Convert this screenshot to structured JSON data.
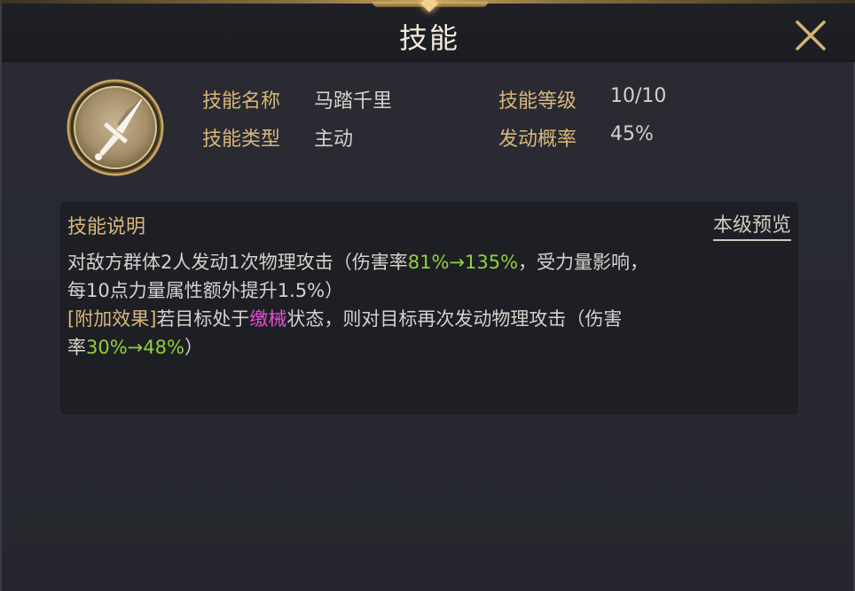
{
  "header": {
    "title": "技能"
  },
  "skill": {
    "name_label": "技能名称",
    "name_value": "马踏千里",
    "level_label": "技能等级",
    "level_value": "10/10",
    "type_label": "技能类型",
    "type_value": "主动",
    "chance_label": "发动概率",
    "chance_value": "45%"
  },
  "description": {
    "title": "技能说明",
    "preview_label": "本级预览",
    "line1_prefix": "对敌方群体2人发动1次物理攻击（伤害率",
    "line1_range": "81%→135%",
    "line1_suffix": "，受力量影响，",
    "line2": "每10点力量属性额外提升1.5%）",
    "line3_tag": "[附加效果]",
    "line3_prefix": "若目标处于",
    "line3_status": "缴械",
    "line3_suffix": "状态，则对目标再次发动物理攻击（伤害",
    "line4_prefix": "率",
    "line4_range": "30%→48%",
    "line4_suffix": "）"
  },
  "colors": {
    "gold_text": "#d9b77a",
    "green_value": "#8fd23a",
    "status_pink": "#e44ed6"
  },
  "icons": {
    "close": "close-icon",
    "skill": "sword-skill-icon"
  }
}
